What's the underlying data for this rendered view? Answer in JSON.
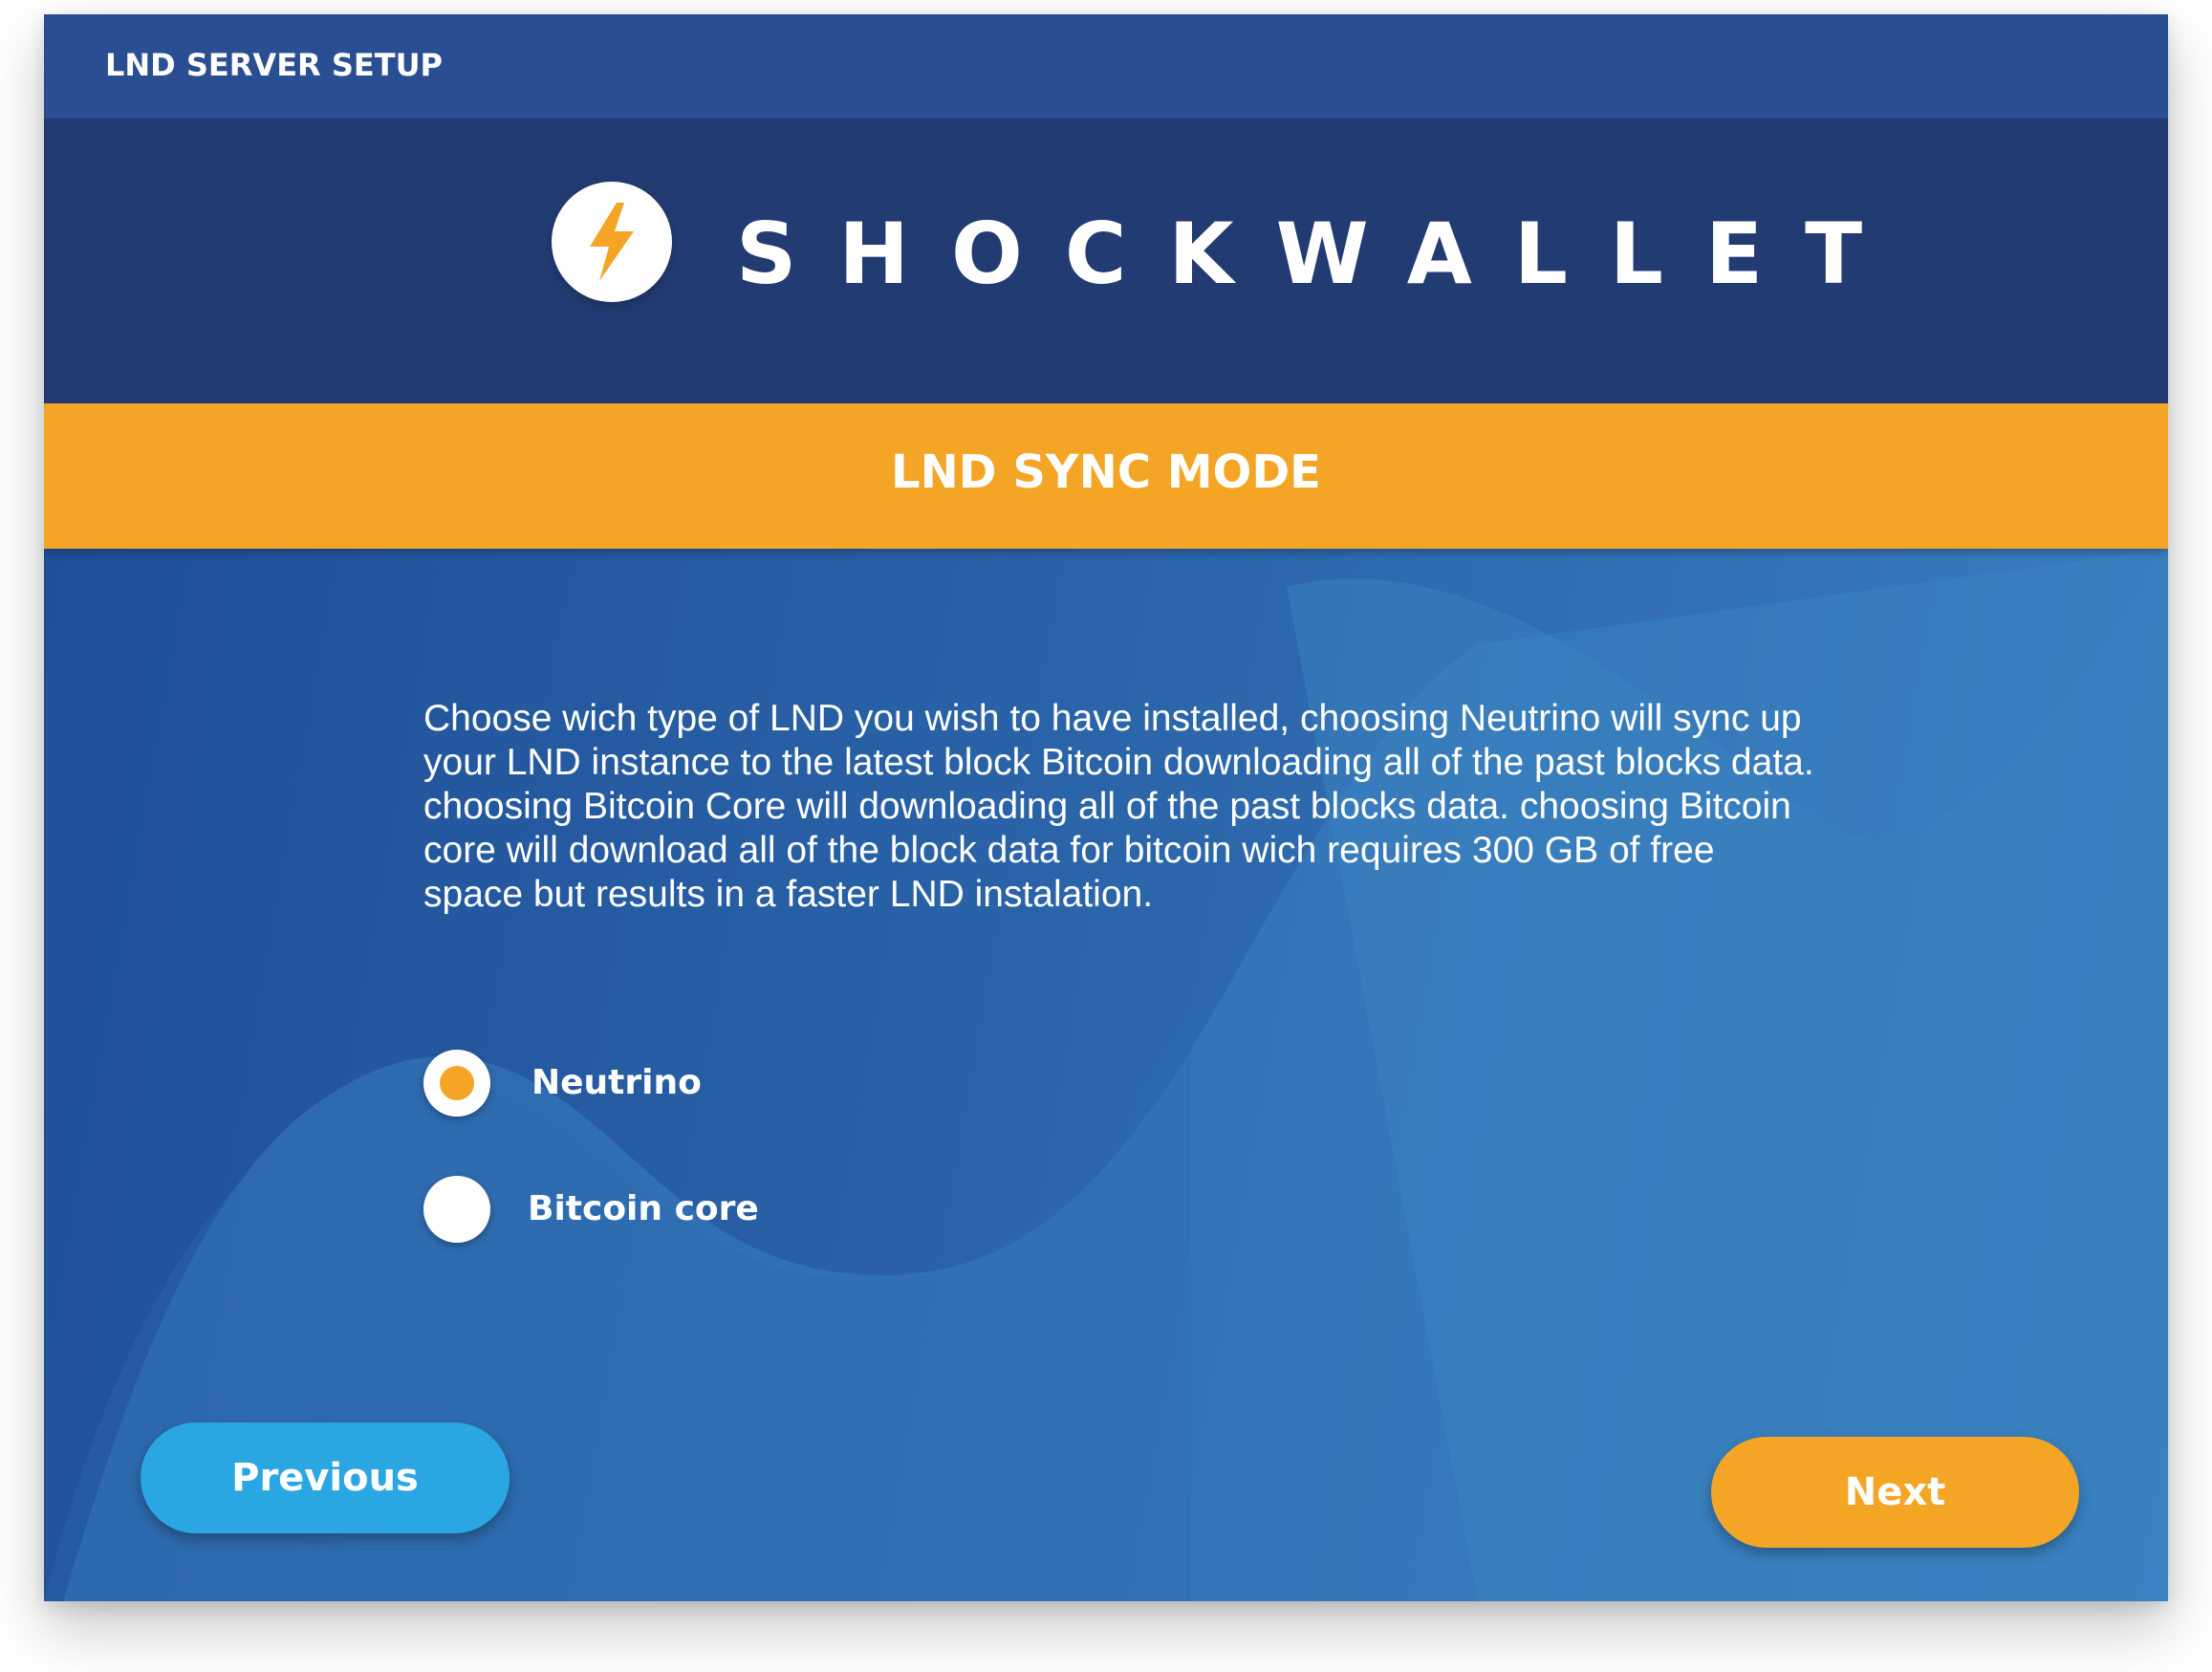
{
  "window": {
    "title": "LND SERVER SETUP"
  },
  "brand": {
    "name": "SHOCKWALLET",
    "logo_icon": "lightning-bolt-icon",
    "logo_bolt_color": "#f4a526"
  },
  "section": {
    "title": "LND SYNC MODE"
  },
  "description": "Choose wich type of LND you wish to have installed, choosing Neutrino will sync up your LND instance to the latest block Bitcoin downloading all of the past blocks data. choosing Bitcoin Core will downloading all of the past blocks data. choosing Bitcoin core will download all of the block data for bitcoin wich requires 300 GB of free space but results in a faster LND instalation.",
  "sync_options": [
    {
      "label": "Neutrino",
      "selected": true
    },
    {
      "label": "Bitcoin core",
      "selected": false
    }
  ],
  "buttons": {
    "previous": "Previous",
    "next": "Next"
  },
  "colors": {
    "titlebar": "#294e92",
    "brand_bar": "#223c73",
    "accent_orange": "#f4a526",
    "previous_button": "#2aa7e2",
    "content_blue": "#2563a7"
  }
}
